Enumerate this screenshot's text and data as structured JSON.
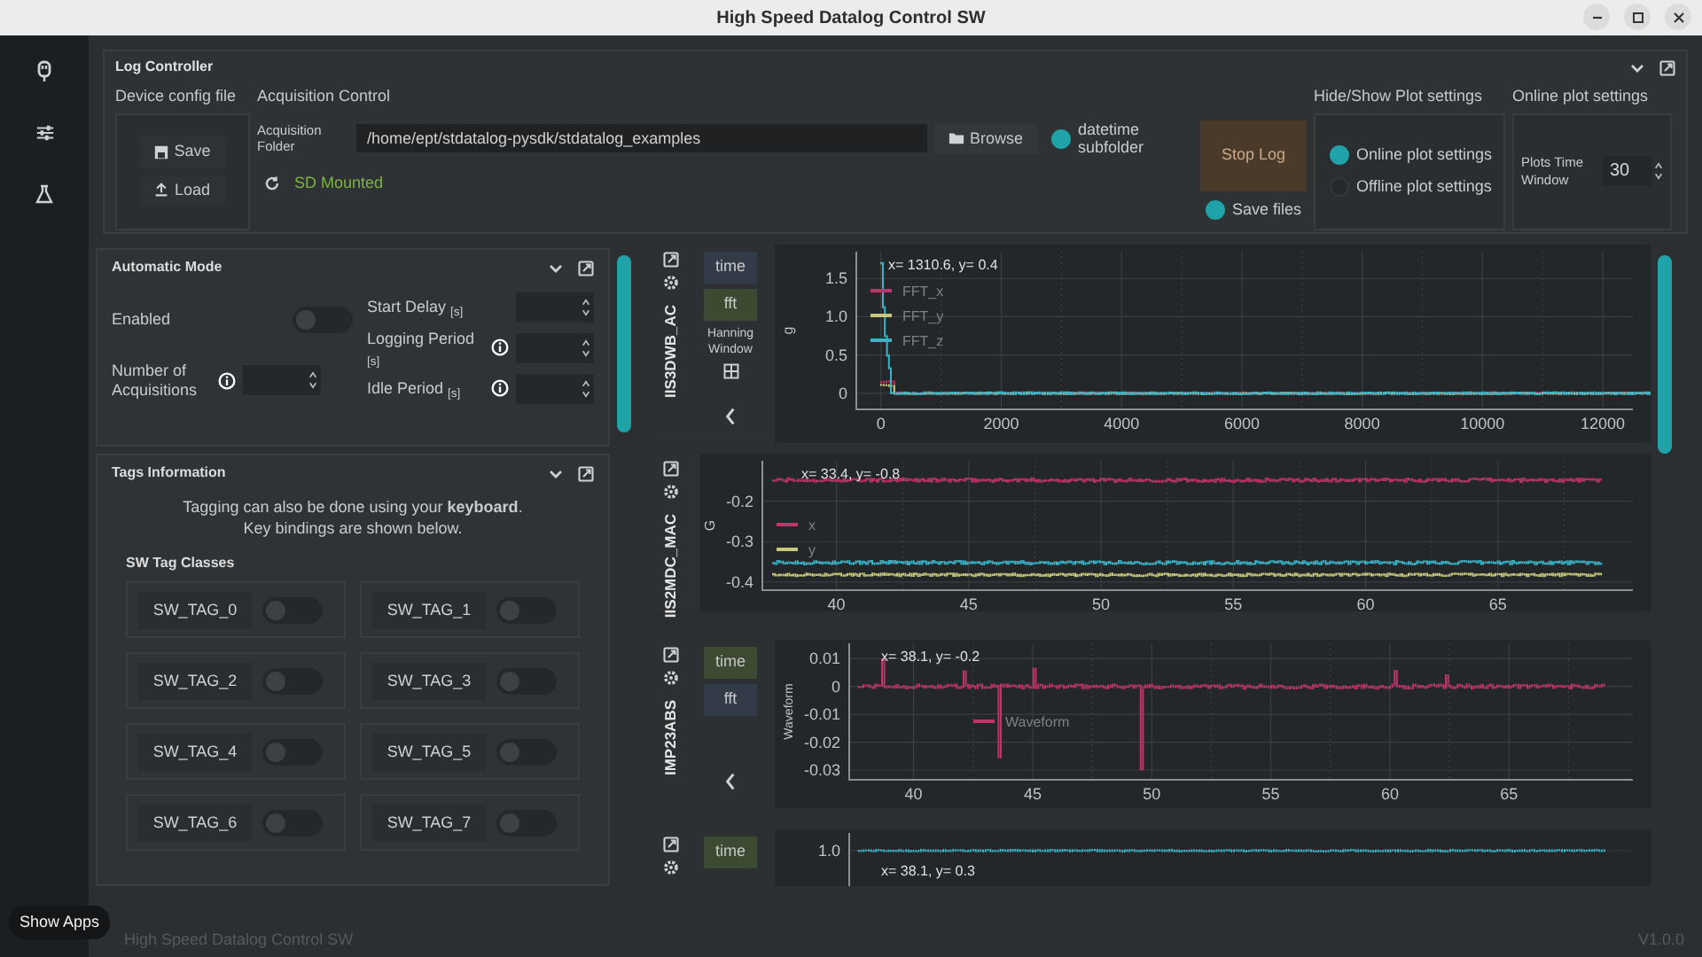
{
  "window": {
    "title": "High Speed Datalog Control SW"
  },
  "log_controller": {
    "title": "Log Controller",
    "device_config": {
      "title": "Device config file",
      "buttons": [
        "Save",
        "Load"
      ]
    },
    "acquisition": {
      "title": "Acquisition Control",
      "folder_label": "Acquisition Folder",
      "folder_value": "/home/ept/stdatalog-pysdk/stdatalog_examples",
      "browse": "Browse",
      "datetime_subfolder": {
        "label": "datetime subfolder",
        "checked": true
      },
      "sd_status": "SD Mounted",
      "stop_log": "Stop Log",
      "save_files": {
        "label": "Save files",
        "checked": true
      }
    },
    "plot_settings": {
      "title": "Hide/Show Plot settings",
      "options": [
        {
          "label": "Online plot settings",
          "selected": true
        },
        {
          "label": "Offline plot settings",
          "selected": false
        }
      ]
    },
    "online_settings": {
      "title": "Online plot settings",
      "time_window_label": "Plots Time Window",
      "time_window": "30"
    }
  },
  "automatic_mode": {
    "title": "Automatic Mode",
    "enabled": {
      "label": "Enabled",
      "on": false
    },
    "acquisitions_label": "Number of Acquisitions",
    "fields": [
      {
        "label": "Start Delay $_{[s]}$",
        "info": false
      },
      {
        "label": "Logging Period $_{[s]}$",
        "info": true
      },
      {
        "label": "Idle Period $_{[s]}$",
        "info": true
      }
    ]
  },
  "tags": {
    "title": "Tags Information",
    "note": "Tagging can also be done using your **keyboard**. Key bindings are shown below.",
    "classes_title": "SW Tag Classes",
    "items": [
      {
        "label": "SW_TAG_0",
        "on": false
      },
      {
        "label": "SW_TAG_1",
        "on": false
      },
      {
        "label": "SW_TAG_2",
        "on": false
      },
      {
        "label": "SW_TAG_3",
        "on": false
      },
      {
        "label": "SW_TAG_4",
        "on": false
      },
      {
        "label": "SW_TAG_5",
        "on": false
      },
      {
        "label": "SW_TAG_6",
        "on": false
      },
      {
        "label": "SW_TAG_7",
        "on": false
      }
    ]
  },
  "plots": [
    {
      "kind": "fft",
      "sensor": "IIS3DWB_AC",
      "modes": [
        {
          "label": "time",
          "selected": false
        },
        {
          "label": "fft",
          "selected": true
        }
      ],
      "window_label": "Hanning Window",
      "ylabel": "g",
      "cursor": "x= 1310.6, y= 0.4",
      "legend": [
        {
          "label": "FFT_x",
          "color": "#c2336b"
        },
        {
          "label": "FFT_y",
          "color": "#c8c87a"
        },
        {
          "label": "FFT_z",
          "color": "#3cb4c8"
        }
      ],
      "yticks": [
        "1.5",
        "1.0",
        "0.5",
        "0"
      ],
      "xticks": [
        "0",
        "2000",
        "4000",
        "6000",
        "8000",
        "10000",
        "12000"
      ]
    },
    {
      "kind": "mag",
      "sensor": "IIS2MDC_MAC",
      "ylabel": "G",
      "cursor": "x= 33.4, y= -0.8",
      "legend": [
        {
          "label": "x",
          "color": "#c2336b"
        },
        {
          "label": "y",
          "color": "#c8c87a"
        }
      ],
      "yticks": [
        "-0.2",
        "-0.3",
        "-0.4"
      ],
      "xticks": [
        "40",
        "45",
        "50",
        "55",
        "60",
        "65"
      ]
    },
    {
      "kind": "audio",
      "sensor": "IMP23ABS",
      "modes": [
        {
          "label": "time",
          "selected": true
        },
        {
          "label": "fft",
          "selected": false
        }
      ],
      "ylabel": "Waveform",
      "cursor": "x= 38.1, y= -0.2",
      "legend": [
        {
          "label": "Waveform",
          "color": "#c2336b"
        }
      ],
      "yticks": [
        "0.01",
        "0",
        "-0.01",
        "-0.02",
        "-0.03"
      ],
      "xticks": [
        "40",
        "45",
        "50",
        "55",
        "60",
        "65"
      ]
    },
    {
      "kind": "partial",
      "modes": [
        {
          "label": "time",
          "selected": true
        }
      ],
      "cursor": "x= 38.1, y= 0.3",
      "yticks": [
        "1.0"
      ]
    }
  ],
  "tooltip": "Show Apps",
  "footer": {
    "app_name": "High Speed Datalog Control SW",
    "version": "V1.0.0"
  }
}
